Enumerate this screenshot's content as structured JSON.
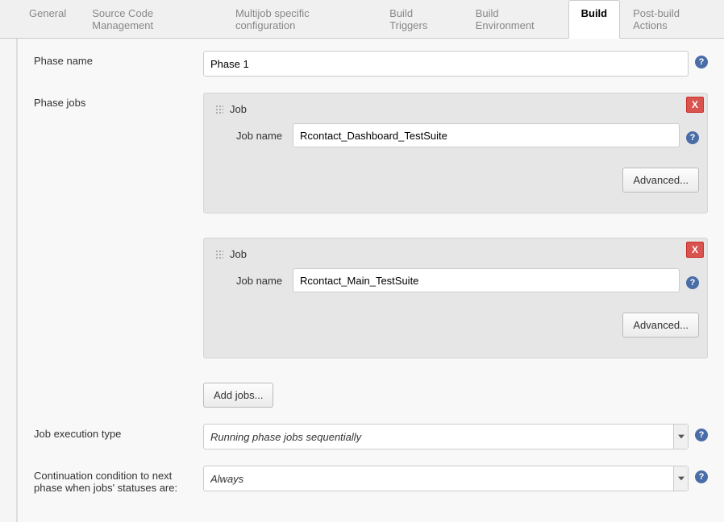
{
  "tabs": {
    "general": "General",
    "scm": "Source Code Management",
    "multijob": "Multijob specific configuration",
    "triggers": "Build Triggers",
    "environment": "Build Environment",
    "build": "Build",
    "postbuild": "Post-build Actions"
  },
  "phase": {
    "name_label": "Phase name",
    "name_value": "Phase 1",
    "jobs_label": "Phase jobs"
  },
  "jobs": [
    {
      "title": "Job",
      "name_label": "Job name",
      "name_value": "Rcontact_Dashboard_TestSuite",
      "advanced": "Advanced...",
      "close": "X"
    },
    {
      "title": "Job",
      "name_label": "Job name",
      "name_value": "Rcontact_Main_TestSuite",
      "advanced": "Advanced...",
      "close": "X"
    }
  ],
  "add_jobs": "Add jobs...",
  "exec_type": {
    "label": "Job execution type",
    "value": "Running phase jobs sequentially"
  },
  "cont_cond": {
    "label": "Continuation condition to next phase when jobs' statuses are:",
    "value": "Always"
  },
  "help": "?"
}
